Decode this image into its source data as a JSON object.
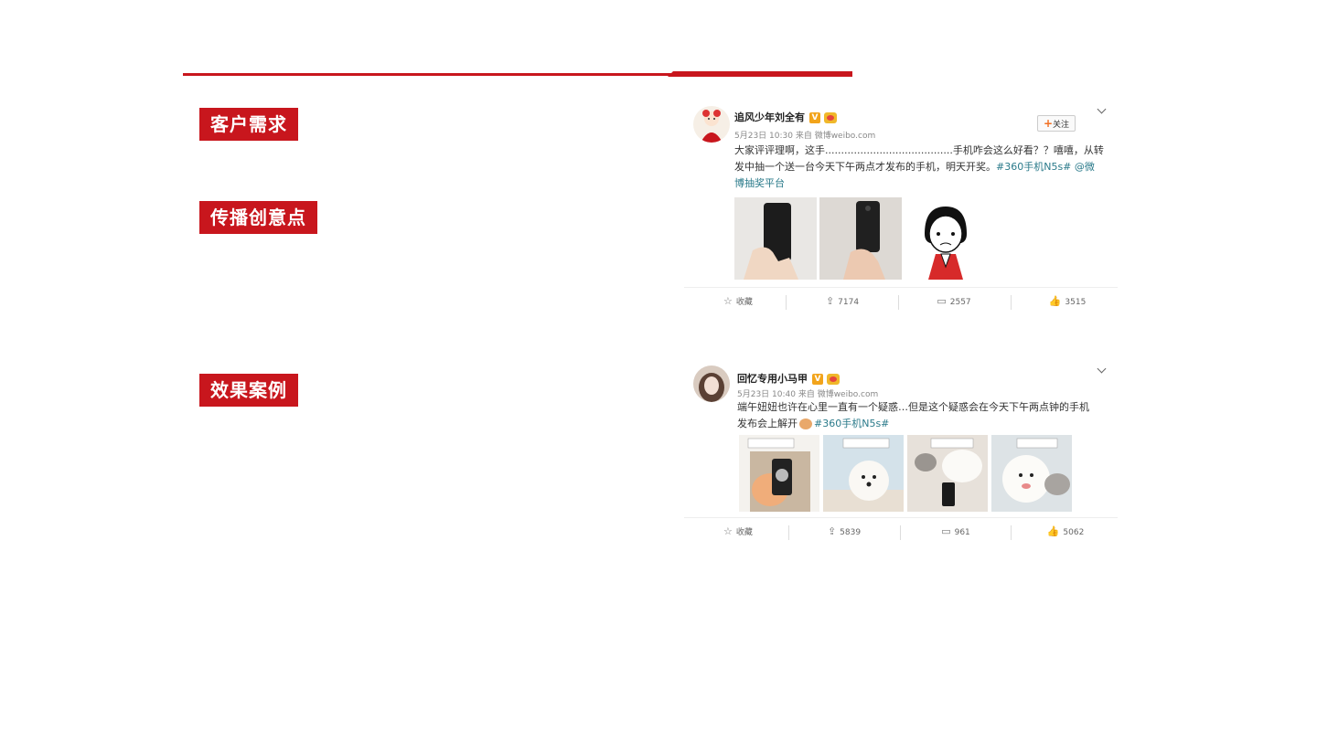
{
  "labels": {
    "need": "客户需求",
    "idea": "传播创意点",
    "case": "效果案例"
  },
  "posts": [
    {
      "username": "追风少年刘全有",
      "meta": "5月23日 10:30 来自 微博weibo.com",
      "follow_label": "关注",
      "text_line1": "大家评评理啊，这手........................................手机咋会这么好看？？嘻嘻，从转",
      "text_line2_plain": "发中抽一个送一台今天下午两点才发布的手机，明天开奖。",
      "text_line2_tag": "#360手机N5s# @微",
      "text_line3_tag": "博抽奖平台",
      "actions": {
        "collect": "收藏",
        "repost": "7174",
        "comment": "2557",
        "like": "3515"
      }
    },
    {
      "username": "回忆专用小马甲",
      "meta": "5月23日 10:40 来自 微博weibo.com",
      "text_line1": "端午妞妞也许在心里一直有一个疑惑…但是这个疑惑会在今天下午两点钟的手机",
      "text_line2_plain": "发布会上解开",
      "text_line2_tag": "#360手机N5s#",
      "actions": {
        "collect": "收藏",
        "repost": "5839",
        "comment": "961",
        "like": "5062"
      }
    }
  ],
  "icons": {
    "verified": "verified-badge-icon",
    "member": "crown-icon",
    "star": "star-icon",
    "repost": "repost-icon",
    "comment": "comment-icon",
    "like": "thumbs-up-icon"
  },
  "colors": {
    "accent": "#c8161d",
    "link": "#2a7a8a"
  }
}
